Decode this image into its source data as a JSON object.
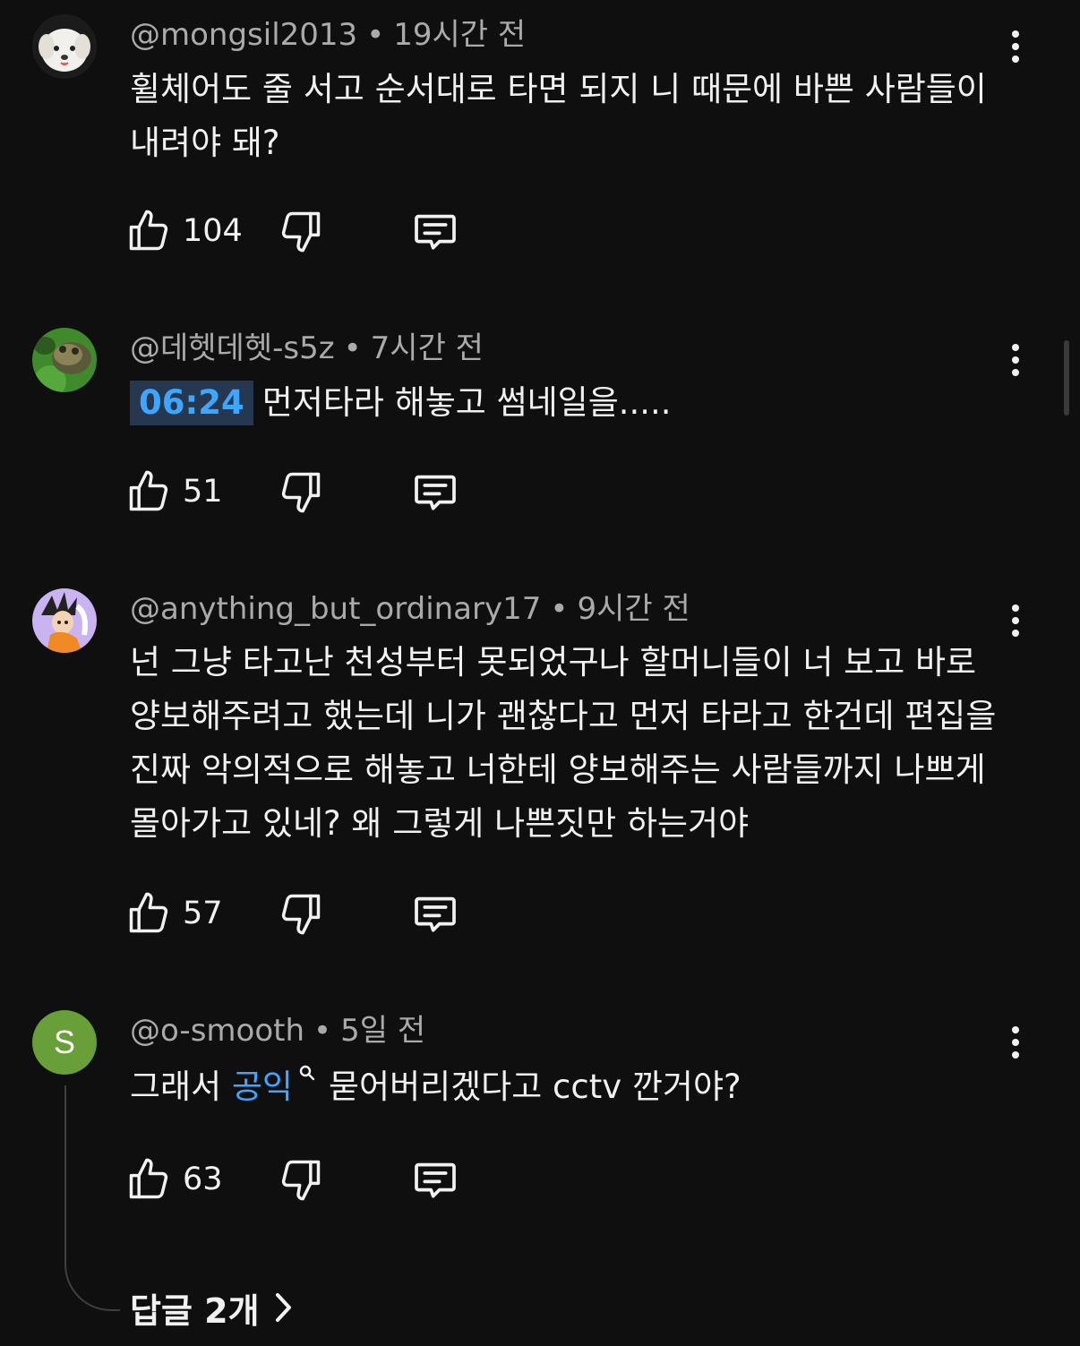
{
  "comments": [
    {
      "author": "@mongsil2013",
      "time": "19시간 전",
      "text": "휠체어도 줄 서고 순서대로 타면 되지 니 때문에 바쁜 사람들이 내려야 돼?",
      "likes": "104",
      "avatar": "white-dog-avatar"
    },
    {
      "author": "@데헷데헷-s5z",
      "time": "7시간 전",
      "timestamp_link": "06:24",
      "text": "먼저타라 해놓고 썸네일을.....",
      "likes": "51",
      "avatar": "frog-avatar"
    },
    {
      "author": "@anything_but_ordinary17",
      "time": "9시간 전",
      "text": "넌 그냥 타고난 천성부터 못되었구나 할머니들이 너 보고 바로 양보해주려고 했는데 니가 괜찮다고 먼저 타라고 한건데 편집을 진짜 악의적으로 해놓고 너한테 양보해주는 사람들까지 나쁘게 몰아가고 있네? 왜 그렇게 나쁜짓만 하는거야",
      "likes": "57",
      "avatar": "anime-character-avatar"
    },
    {
      "author": "@o-smooth",
      "time": "5일 전",
      "text_before": "그래서",
      "link_text": "공익",
      "text_after": "묻어버리겠다고 cctv 깐거야?",
      "likes": "63",
      "avatar_letter": "S",
      "avatar_color": "#689f38"
    }
  ],
  "replies_label": "답글 2개",
  "icons": {
    "like": "thumbs-up-icon",
    "dislike": "thumbs-down-icon",
    "reply": "comment-icon",
    "more": "more-vert-icon",
    "search": "search-icon",
    "chevron": "chevron-right-icon"
  },
  "colors": {
    "background": "#0f0f0f",
    "link": "#3ea6ff",
    "meta": "#aaaaaa"
  }
}
